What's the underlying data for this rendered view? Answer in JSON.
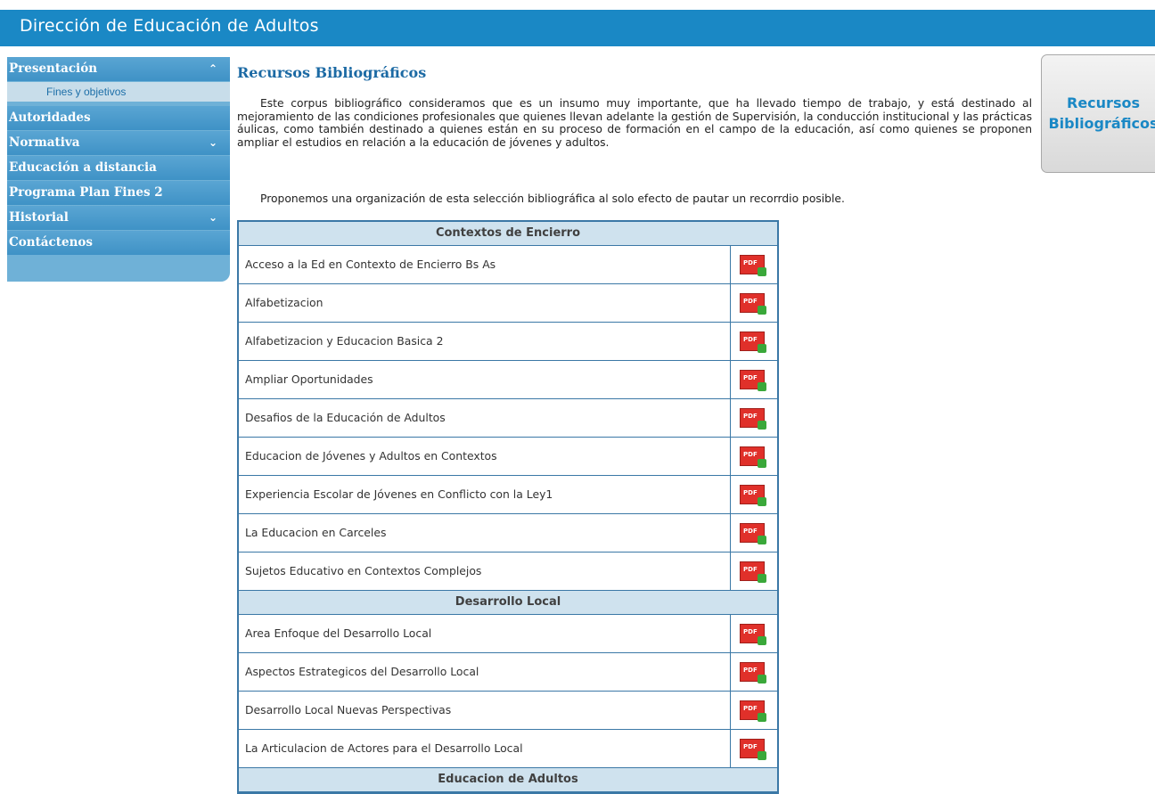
{
  "header": {
    "title": "Dirección de Educación de Adultos"
  },
  "sidebar": {
    "items": [
      {
        "label": "Presentación",
        "chevron": "up"
      },
      {
        "label": "Autoridades"
      },
      {
        "label": "Normativa",
        "chevron": "down"
      },
      {
        "label": "Educación a distancia"
      },
      {
        "label": "Programa Plan Fines 2"
      },
      {
        "label": "Historial",
        "chevron": "down"
      },
      {
        "label": "Contáctenos"
      }
    ],
    "submenu": {
      "label": "Fines y objetivos"
    }
  },
  "content": {
    "title": "Recursos Bibliográficos",
    "paragraph1": "Este corpus bibliográfico consideramos que es un insumo muy importante, que ha llevado tiempo de trabajo, y está destinado al mejoramiento de las condiciones profesionales que quienes llevan adelante la gestión de Supervisión, la conducción institucional y las prácticas áulicas, como también destinado a quienes están en su proceso de formación en el campo de la educación, así como quienes se proponen ampliar el estudios en relación a la educación de jóvenes y adultos.",
    "paragraph2": "Proponemos una organización de esta selección  bibliográfica al solo efecto de pautar un recorrdio posible."
  },
  "side_button": {
    "line1": "Recursos",
    "line2": "Bibliográficos"
  },
  "table": {
    "sections": [
      {
        "title": "Contextos de Encierro",
        "rows": [
          "Acceso a la Ed en Contexto de Encierro Bs As",
          "Alfabetizacion",
          "Alfabetizacion y Educacion Basica 2",
          "Ampliar Oportunidades",
          "Desafios de la Educación de Adultos",
          "Educacion de Jóvenes y Adultos en Contextos",
          "Experiencia Escolar de Jóvenes en Conflicto con la Ley1",
          "La Educacion en Carceles",
          "Sujetos Educativo en Contextos Complejos"
        ]
      },
      {
        "title": "Desarrollo Local",
        "rows": [
          "Area Enfoque del Desarrollo Local",
          "Aspectos Estrategicos del Desarrollo Local",
          "Desarrollo Local Nuevas Perspectivas",
          "La Articulacion de Actores para el Desarrollo Local"
        ]
      },
      {
        "title": "Educacion de Adultos",
        "rows": []
      }
    ],
    "pdf_icon": "pdf-download-icon",
    "pdf_icon_text": "PDF"
  },
  "colors": {
    "header_bg": "#1a88c5",
    "sidebar_bg": "#6fb1d7",
    "title_blue": "#1c6aa4",
    "table_border": "#3b78a6",
    "section_bg": "#cfe2ee"
  }
}
